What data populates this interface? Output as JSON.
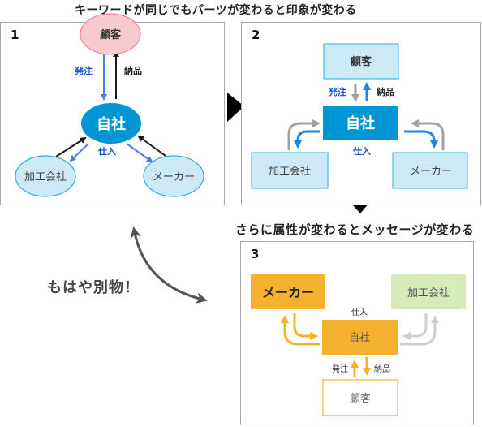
{
  "headings": {
    "top": "キーワードが同じでもパーツが変わると印象が変わる",
    "middle": "さらに属性が変わるとメッセージが変わる"
  },
  "side_label": "もはや別物！",
  "colors": {
    "blue_main": "#0096d6",
    "blue_light_fill": "#cce9f6",
    "blue_light_stroke": "#3aa9dc",
    "blue_arrow": "#4a7fe0",
    "label_blue": "#1a56d6",
    "pink_fill": "#f9c9d0",
    "pink_stroke": "#e88a98",
    "gray_arrow": "#a0a0a0",
    "orange": "#f4b12e",
    "green_light": "#d7eab9",
    "gray_light_arrow": "#cfcfcf"
  },
  "panel1": {
    "number": "1",
    "nodes": {
      "customer": "顧客",
      "company": "自社",
      "processor": "加工会社",
      "maker": "メーカー"
    },
    "labels": {
      "order": "発注",
      "delivery": "納品",
      "purchase": "仕入"
    }
  },
  "panel2": {
    "number": "2",
    "nodes": {
      "customer": "顧客",
      "company": "自社",
      "processor": "加工会社",
      "maker": "メーカー"
    },
    "labels": {
      "order": "発注",
      "delivery": "納品",
      "purchase": "仕入"
    }
  },
  "panel3": {
    "number": "3",
    "nodes": {
      "maker": "メーカー",
      "processor": "加工会社",
      "company": "自社",
      "customer": "顧客"
    },
    "labels": {
      "purchase": "仕入",
      "order": "発注",
      "delivery": "納品"
    }
  }
}
